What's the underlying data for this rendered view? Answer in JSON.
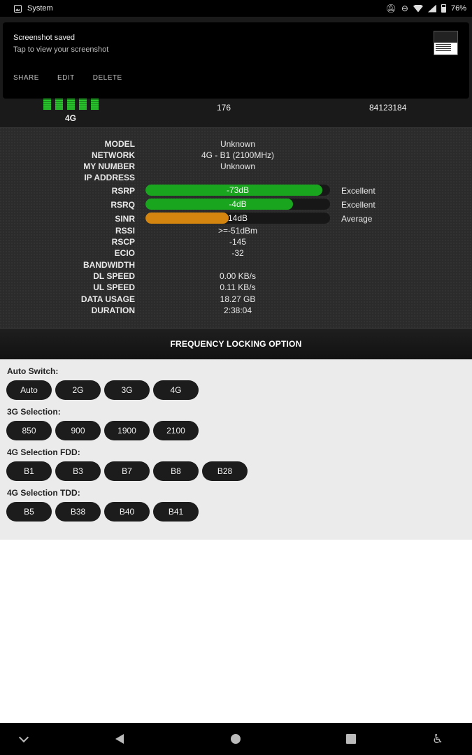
{
  "status_bar": {
    "app_label": "System",
    "battery_percent": "76%",
    "icons": [
      "image-icon",
      "bell-off-icon",
      "dnd-icon",
      "wifi-icon",
      "signal-icon",
      "battery-icon"
    ]
  },
  "notification": {
    "title": "Screenshot saved",
    "subtitle": "Tap to view your screenshot",
    "actions": [
      "SHARE",
      "EDIT",
      "DELETE"
    ]
  },
  "signal_header": {
    "network_type": "4G",
    "pci": "176",
    "cell_id": "84123184",
    "bar_color": "#29c52c"
  },
  "info": {
    "model": {
      "label": "MODEL",
      "value": "Unknown"
    },
    "network": {
      "label": "NETWORK",
      "value": "4G - B1 (2100MHz)"
    },
    "my_number": {
      "label": "MY NUMBER",
      "value": "Unknown"
    },
    "ip_address": {
      "label": "IP ADDRESS",
      "value": ""
    },
    "rsrp": {
      "label": "RSRP",
      "value": "-73dB",
      "quality": "Excellent",
      "level": 0.96,
      "color": "#1aa51f"
    },
    "rsrq": {
      "label": "RSRQ",
      "value": "-4dB",
      "quality": "Excellent",
      "level": 0.8,
      "color": "#1aa51f"
    },
    "sinr": {
      "label": "SINR",
      "value": "14dB",
      "quality": "Average",
      "level": 0.45,
      "color": "#d4850f"
    },
    "rssi": {
      "label": "RSSI",
      "value": ">=-51dBm"
    },
    "rscp": {
      "label": "RSCP",
      "value": "-145"
    },
    "ecio": {
      "label": "ECIO",
      "value": "-32"
    },
    "bandwidth": {
      "label": "BANDWIDTH",
      "value": ""
    },
    "dl_speed": {
      "label": "DL SPEED",
      "value": "0.00 KB/s"
    },
    "ul_speed": {
      "label": "UL SPEED",
      "value": "0.11 KB/s"
    },
    "data_usage": {
      "label": "DATA USAGE",
      "value": "18.27 GB"
    },
    "duration": {
      "label": "DURATION",
      "value": "2:38:04"
    }
  },
  "frequency": {
    "header": "FREQUENCY LOCKING OPTION",
    "auto_switch": {
      "label": "Auto Switch:",
      "options": [
        "Auto",
        "2G",
        "3G",
        "4G"
      ]
    },
    "g3_selection": {
      "label": "3G Selection:",
      "options": [
        "850",
        "900",
        "1900",
        "2100"
      ]
    },
    "fdd_selection": {
      "label": "4G Selection FDD:",
      "options": [
        "B1",
        "B3",
        "B7",
        "B8",
        "B28"
      ]
    },
    "tdd_selection": {
      "label": "4G Selection TDD:",
      "options": [
        "B5",
        "B38",
        "B40",
        "B41"
      ]
    }
  },
  "nav_bar": {
    "icons": [
      "chevron-down-icon",
      "back-icon",
      "home-icon",
      "recents-icon",
      "accessibility-icon"
    ]
  }
}
